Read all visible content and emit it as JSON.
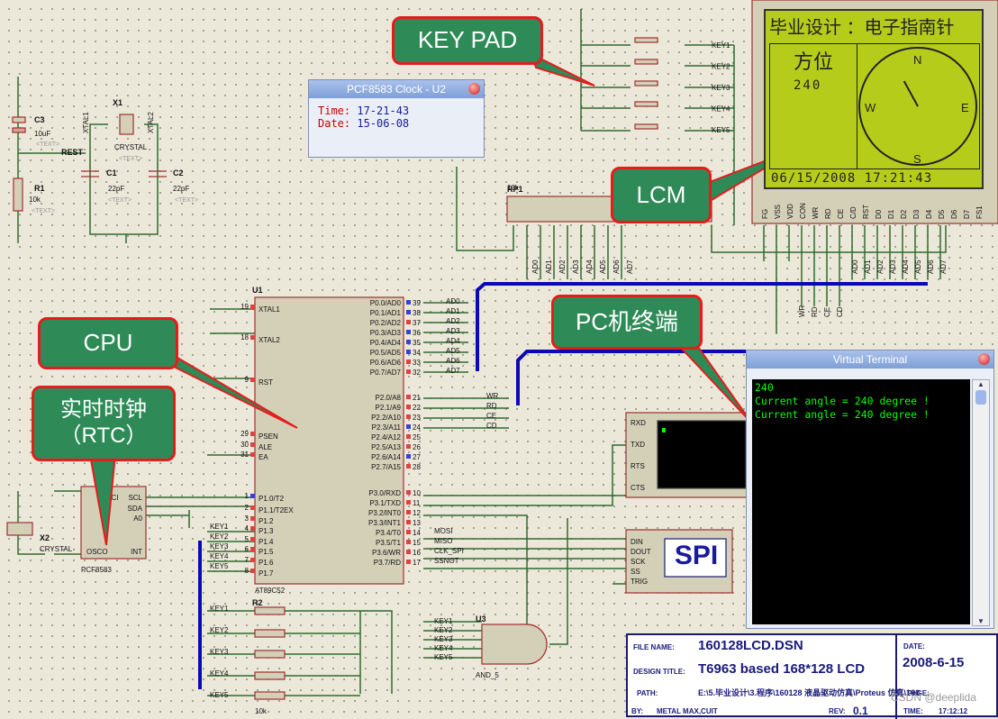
{
  "callouts": {
    "keypad": "KEY PAD",
    "lcm": "LCM",
    "cpu": "CPU",
    "rtc_line1": "实时时钟",
    "rtc_line2": "（RTC）",
    "pc": "PC机终端"
  },
  "clock_window": {
    "title": "PCF8583 Clock - U2",
    "time_label": "Time:",
    "time": "17-21-43",
    "date_label": "Date:",
    "date": "15-06-08"
  },
  "terminal": {
    "title": "Virtual Terminal",
    "lines": [
      "240",
      "Current angle = 240 degree !",
      "Current angle = 240 degree !"
    ]
  },
  "lcd": {
    "title": "毕业设计 ：电子指南针",
    "heading": "方位",
    "value": "240",
    "datetime": "06/15/2008 17:21:43",
    "compass": {
      "n": "N",
      "e": "E",
      "s": "S",
      "w": "W"
    },
    "heading_deg": 240,
    "pins": [
      "FG",
      "VSS",
      "VDD",
      "CON",
      "WR",
      "RD",
      "CE",
      "C/D",
      "RST",
      "D0",
      "D1",
      "D2",
      "D3",
      "D4",
      "D5",
      "D6",
      "D7",
      "FS1"
    ]
  },
  "components": {
    "c3": {
      "ref": "C3",
      "val": "10uF"
    },
    "r1": {
      "ref": "R1",
      "val": "10k"
    },
    "x1": {
      "ref": "X1",
      "val": "CRYSTAL"
    },
    "c1": {
      "ref": "C1",
      "val": "22pF"
    },
    "c2": {
      "ref": "C2",
      "val": "22pF"
    },
    "rest": "REST",
    "xtal1": "XTAL1",
    "xtal2": "XTAL2",
    "rp1": {
      "ref": "RP1",
      "val": "10k"
    },
    "u1": {
      "ref": "U1",
      "part": "AT89C52"
    },
    "u2": {
      "part": "PCF8583"
    },
    "x2": {
      "ref": "X2",
      "val": "CRYSTAL"
    },
    "r2": {
      "ref": "R2",
      "val": "10k"
    },
    "u3": {
      "ref": "U3",
      "part": "AND_5"
    },
    "text_placeholder": "<TEXT>",
    "spi": "SPI"
  },
  "u1_left": [
    [
      "XTAL1",
      "19"
    ],
    [
      "XTAL2",
      "18"
    ],
    [
      "RST",
      "9"
    ],
    [
      "PSEN",
      "29"
    ],
    [
      "ALE",
      "30"
    ],
    [
      "EA",
      "31"
    ],
    [
      "P1.0/T2",
      "1"
    ],
    [
      "P1.1/T2EX",
      "2"
    ],
    [
      "P1.2",
      "3"
    ],
    [
      "P1.3",
      "4"
    ],
    [
      "P1.4",
      "5"
    ],
    [
      "P1.5",
      "6"
    ],
    [
      "P1.6",
      "7"
    ],
    [
      "P1.7",
      "8"
    ]
  ],
  "u1_right": [
    [
      "P0.0/AD0",
      "39",
      "AD0"
    ],
    [
      "P0.1/AD1",
      "38",
      "AD1"
    ],
    [
      "P0.2/AD2",
      "37",
      "AD2"
    ],
    [
      "P0.3/AD3",
      "36",
      "AD3"
    ],
    [
      "P0.4/AD4",
      "35",
      "AD4"
    ],
    [
      "P0.5/AD5",
      "34",
      "AD5"
    ],
    [
      "P0.6/AD6",
      "33",
      "AD6"
    ],
    [
      "P0.7/AD7",
      "32",
      "AD7"
    ],
    [
      "P2.0/A8",
      "21",
      "WR"
    ],
    [
      "P2.1/A9",
      "22",
      "RD"
    ],
    [
      "P2.2/A10",
      "23",
      "CE"
    ],
    [
      "P2.3/A11",
      "24",
      "CD"
    ],
    [
      "P2.4/A12",
      "25",
      ""
    ],
    [
      "P2.5/A13",
      "26",
      ""
    ],
    [
      "P2.6/A14",
      "27",
      ""
    ],
    [
      "P2.7/A15",
      "28",
      ""
    ],
    [
      "P3.0/RXD",
      "10",
      ""
    ],
    [
      "P3.1/TXD",
      "11",
      ""
    ],
    [
      "P3.2/INT0",
      "12",
      ""
    ],
    [
      "P3.3/INT1",
      "13",
      ""
    ],
    [
      "P3.4/T0",
      "14",
      "MOSI"
    ],
    [
      "P3.5/T1",
      "15",
      "MISO"
    ],
    [
      "P3.6/WR",
      "16",
      "CLK_SPI"
    ],
    [
      "P3.7/RD",
      "17",
      "SSNOT"
    ]
  ],
  "u2_pins": {
    "left": [
      "OSCI",
      "OSCO"
    ],
    "right": [
      "SCL",
      "SDA",
      "A0",
      "INT"
    ]
  },
  "keys": [
    "KEY1",
    "KEY2",
    "KEY3",
    "KEY4",
    "KEY5"
  ],
  "bus_labels_lcd": [
    "AD0",
    "AD1",
    "AD2",
    "AD3",
    "AD4",
    "AD5",
    "AD6",
    "AD7"
  ],
  "ctrl_labels": [
    "WR",
    "RD",
    "CE",
    "CD"
  ],
  "serial_pins": [
    "RXD",
    "TXD",
    "RTS",
    "CTS"
  ],
  "spi_pins": [
    "DIN",
    "DOUT",
    "SCK",
    "SS",
    "TRIG"
  ],
  "title_block": {
    "file_name_label": "FILE NAME:",
    "file_name": "160128LCD.DSN",
    "design_title_label": "DESIGN TITLE:",
    "design_title": "T6963 based 168*128  LCD",
    "path_label": "PATH:",
    "path": "E:\\5.毕业设计\\3.程序\\160128 液晶驱动仿真\\Proteus 仿真\\160",
    "by_label": "BY:",
    "by": "METAL MAX,CUIT",
    "rev_label": "REV:",
    "rev": "0.1",
    "date_label": "DATE:",
    "date": "2008-6-15",
    "page_label": "PAGE:",
    "time_label": "TIME:",
    "time": "17:12:12"
  },
  "watermark": "CSDN @deeplida",
  "colors": {
    "wire": "#2f6b2f",
    "bus": "#0a0ab4",
    "component_fill": "#d4d0b8",
    "component_border": "#a03030",
    "callout": "#2e8b57",
    "callout_border": "#e51c1c",
    "lcd": "#b5cc1a"
  }
}
